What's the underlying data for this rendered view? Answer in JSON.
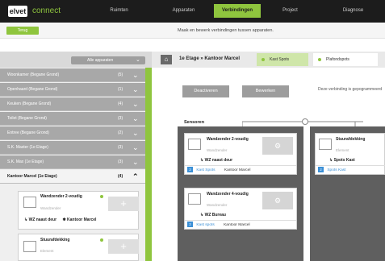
{
  "brand": {
    "logo": "elvet",
    "name": "connect"
  },
  "nav": {
    "tabs": [
      "Ruimten",
      "Apparaten",
      "Verbindingen",
      "Project",
      "Diagnose"
    ],
    "active": "Verbindingen"
  },
  "subbar": {
    "back": "Terug",
    "subtitle": "Maak en bewerk verbindingen tussen apparaten."
  },
  "sidebar": {
    "filter": "Alle apparaten",
    "rooms": [
      {
        "name": "Woonkamer (Begane Grond)",
        "count": "(5)"
      },
      {
        "name": "Openhaard (Begane Grond)",
        "count": "(1)"
      },
      {
        "name": "Keuken (Begane Grond)",
        "count": "(4)"
      },
      {
        "name": "Toilet (Begane Grond)",
        "count": "(3)"
      },
      {
        "name": "Entree (Begane Grond)",
        "count": "(2)"
      },
      {
        "name": "S.K. Master (1e Etage)",
        "count": "(3)"
      },
      {
        "name": "S.K. Max (1e Etage)",
        "count": "(3)"
      },
      {
        "name": "Kantoor Marcel (1e Etage)",
        "count": "(4)"
      }
    ],
    "devices": [
      {
        "title": "Wandzender 2-voudig",
        "sub": "Wandzender",
        "link_left": "WZ naast deur",
        "link_right": "Kantoor Marcel"
      },
      {
        "title": "Stuurafdekking",
        "sub": "Element"
      }
    ]
  },
  "main": {
    "breadcrumb": "1e Etage » Kantoor Marcel",
    "tabs": [
      "Kast Spots",
      "Plafondspots"
    ],
    "buttons": {
      "deactivate": "Deactiveren",
      "edit": "Bewerken"
    },
    "note": "Deze verbinding is gepogrammeerd",
    "sensors_label": "Sensoren",
    "sensor_cards": [
      {
        "title": "Wandzender 2-voudig",
        "sub": "Wandzender",
        "row": "WZ naast deur",
        "num": "2",
        "foot_left": "Kast Spots",
        "foot_right": "Kantoor Marcel"
      },
      {
        "title": "Wandzender 4-voudig",
        "sub": "Wandzender",
        "row": "WZ Bureau",
        "num": "2",
        "foot_left": "Kast spots",
        "foot_right": "Kantoor Marcel"
      }
    ],
    "actuator_card": {
      "title": "Stuurafdekking",
      "sub": "Element",
      "row": "Spots Kast",
      "num": "2",
      "foot_left": "Spots Kast"
    }
  },
  "colors": {
    "accent": "#8fc53e",
    "nav_bg": "#1c1c1c",
    "panel": "#5f5f5f"
  }
}
